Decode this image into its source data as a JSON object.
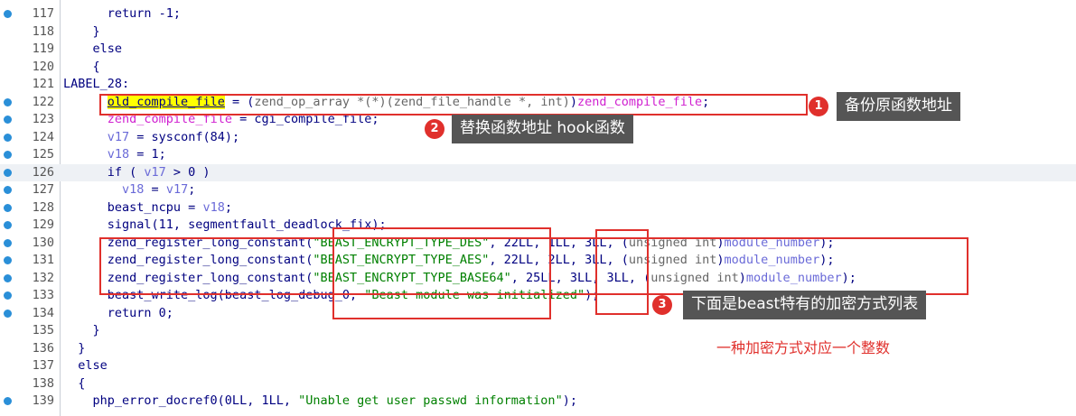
{
  "lines": [
    {
      "n": "117",
      "dot": true,
      "hl": false,
      "segs": [
        {
          "t": "      return -1;",
          "c": ""
        }
      ]
    },
    {
      "n": "118",
      "dot": false,
      "hl": false,
      "segs": [
        {
          "t": "    }",
          "c": ""
        }
      ]
    },
    {
      "n": "119",
      "dot": false,
      "hl": false,
      "segs": [
        {
          "t": "    else",
          "c": ""
        }
      ]
    },
    {
      "n": "120",
      "dot": false,
      "hl": false,
      "segs": [
        {
          "t": "    {",
          "c": ""
        }
      ]
    },
    {
      "n": "121",
      "dot": false,
      "hl": false,
      "segs": [
        {
          "t": "LABEL_28:",
          "c": ""
        }
      ]
    },
    {
      "n": "122",
      "dot": true,
      "hl": false,
      "segs": [
        {
          "t": "      ",
          "c": ""
        },
        {
          "t": "old_compile_file",
          "c": "c-yel c-under"
        },
        {
          "t": " = (",
          "c": ""
        },
        {
          "t": "zend_op_array *(*)(zend_file_handle *, int)",
          "c": "c-gray"
        },
        {
          "t": ")",
          "c": ""
        },
        {
          "t": "zend_compile_file",
          "c": "c-mag"
        },
        {
          "t": ";",
          "c": ""
        }
      ]
    },
    {
      "n": "123",
      "dot": true,
      "hl": false,
      "segs": [
        {
          "t": "      ",
          "c": ""
        },
        {
          "t": "zend_compile_file",
          "c": "c-mag"
        },
        {
          "t": " = cgi_compile_file;",
          "c": ""
        }
      ]
    },
    {
      "n": "124",
      "dot": true,
      "hl": false,
      "segs": [
        {
          "t": "      ",
          "c": ""
        },
        {
          "t": "v17",
          "c": "c-var"
        },
        {
          "t": " = sysconf(84);",
          "c": ""
        }
      ]
    },
    {
      "n": "125",
      "dot": true,
      "hl": false,
      "segs": [
        {
          "t": "      ",
          "c": ""
        },
        {
          "t": "v18",
          "c": "c-var"
        },
        {
          "t": " = 1;",
          "c": ""
        }
      ]
    },
    {
      "n": "126",
      "dot": true,
      "hl": true,
      "segs": [
        {
          "t": "      if ( ",
          "c": ""
        },
        {
          "t": "v17",
          "c": "c-var"
        },
        {
          "t": " > 0 )",
          "c": ""
        }
      ]
    },
    {
      "n": "127",
      "dot": true,
      "hl": false,
      "segs": [
        {
          "t": "        ",
          "c": ""
        },
        {
          "t": "v18",
          "c": "c-var"
        },
        {
          "t": " = ",
          "c": ""
        },
        {
          "t": "v17",
          "c": "c-var"
        },
        {
          "t": ";",
          "c": ""
        }
      ]
    },
    {
      "n": "128",
      "dot": true,
      "hl": false,
      "segs": [
        {
          "t": "      beast_ncpu = ",
          "c": ""
        },
        {
          "t": "v18",
          "c": "c-var"
        },
        {
          "t": ";",
          "c": ""
        }
      ]
    },
    {
      "n": "129",
      "dot": true,
      "hl": false,
      "segs": [
        {
          "t": "      signal(11, segmentfault_deadlock_fix);",
          "c": ""
        }
      ]
    },
    {
      "n": "130",
      "dot": true,
      "hl": false,
      "segs": [
        {
          "t": "      zend_register_long_constant(",
          "c": ""
        },
        {
          "t": "\"BEAST_ENCRYPT_TYPE_DES\"",
          "c": "c-green"
        },
        {
          "t": ", 22LL, 1LL, 3LL, (",
          "c": ""
        },
        {
          "t": "unsigned int",
          "c": "c-gray"
        },
        {
          "t": ")",
          "c": ""
        },
        {
          "t": "module_number",
          "c": "c-var"
        },
        {
          "t": ");",
          "c": ""
        }
      ]
    },
    {
      "n": "131",
      "dot": true,
      "hl": false,
      "segs": [
        {
          "t": "      zend_register_long_constant(",
          "c": ""
        },
        {
          "t": "\"BEAST_ENCRYPT_TYPE_AES\"",
          "c": "c-green"
        },
        {
          "t": ", 22LL, 2LL, 3LL, (",
          "c": ""
        },
        {
          "t": "unsigned int",
          "c": "c-gray"
        },
        {
          "t": ")",
          "c": ""
        },
        {
          "t": "module_number",
          "c": "c-var"
        },
        {
          "t": ");",
          "c": ""
        }
      ]
    },
    {
      "n": "132",
      "dot": true,
      "hl": false,
      "segs": [
        {
          "t": "      zend_register_long_constant(",
          "c": ""
        },
        {
          "t": "\"BEAST_ENCRYPT_TYPE_BASE64\"",
          "c": "c-green"
        },
        {
          "t": ", 25LL, 3LL, 3LL, (",
          "c": ""
        },
        {
          "t": "unsigned int",
          "c": "c-gray"
        },
        {
          "t": ")",
          "c": ""
        },
        {
          "t": "module_number",
          "c": "c-var"
        },
        {
          "t": ");",
          "c": ""
        }
      ]
    },
    {
      "n": "133",
      "dot": true,
      "hl": false,
      "segs": [
        {
          "t": "      beast_write_log(beast_log_debug_0, ",
          "c": ""
        },
        {
          "t": "\"Beast module was initialized\"",
          "c": "c-green"
        },
        {
          "t": ");",
          "c": ""
        }
      ]
    },
    {
      "n": "134",
      "dot": true,
      "hl": false,
      "segs": [
        {
          "t": "      return 0;",
          "c": ""
        }
      ]
    },
    {
      "n": "135",
      "dot": false,
      "hl": false,
      "segs": [
        {
          "t": "    }",
          "c": ""
        }
      ]
    },
    {
      "n": "136",
      "dot": false,
      "hl": false,
      "segs": [
        {
          "t": "  }",
          "c": ""
        }
      ]
    },
    {
      "n": "137",
      "dot": false,
      "hl": false,
      "segs": [
        {
          "t": "  else",
          "c": ""
        }
      ]
    },
    {
      "n": "138",
      "dot": false,
      "hl": false,
      "segs": [
        {
          "t": "  {",
          "c": ""
        }
      ]
    },
    {
      "n": "139",
      "dot": true,
      "hl": false,
      "segs": [
        {
          "t": "    php_error_docref0(0LL, 1LL, ",
          "c": ""
        },
        {
          "t": "\"Unable get user passwd information\"",
          "c": "c-green"
        },
        {
          "t": ");",
          "c": ""
        }
      ]
    }
  ],
  "annotations": {
    "badge1": "1",
    "tip1": "备份原函数地址",
    "badge2": "2",
    "tip2": "替换函数地址 hook函数",
    "badge3": "3",
    "tip3": "下面是beast特有的加密方式列表",
    "note": "一种加密方式对应一个整数"
  },
  "colors": {
    "annotation_red": "#e0302c",
    "tip_bg": "#555555",
    "breakpoint_dot": "#2a8fd8"
  }
}
